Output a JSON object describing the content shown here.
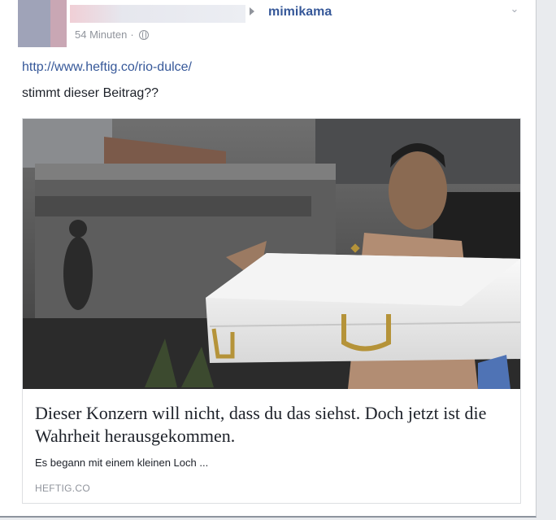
{
  "post": {
    "page_name": "mimikama",
    "timestamp": "54 Minuten",
    "separator": "·",
    "link_url": "http://www.heftig.co/rio-dulce/",
    "message": "stimmt dieser Beitrag??",
    "audience_icon": "globe-icon",
    "menu_icon": "chevron-down-icon"
  },
  "link_card": {
    "title": "Dieser Konzern will nicht, dass du das siehst. Doch jetzt ist die Wahrheit herausgekommen.",
    "description": "Es begann mit einem kleinen Loch ...",
    "domain": "HEFTIG.CO"
  },
  "colors": {
    "link": "#365899",
    "meta": "#90949c",
    "text": "#1d2129"
  }
}
